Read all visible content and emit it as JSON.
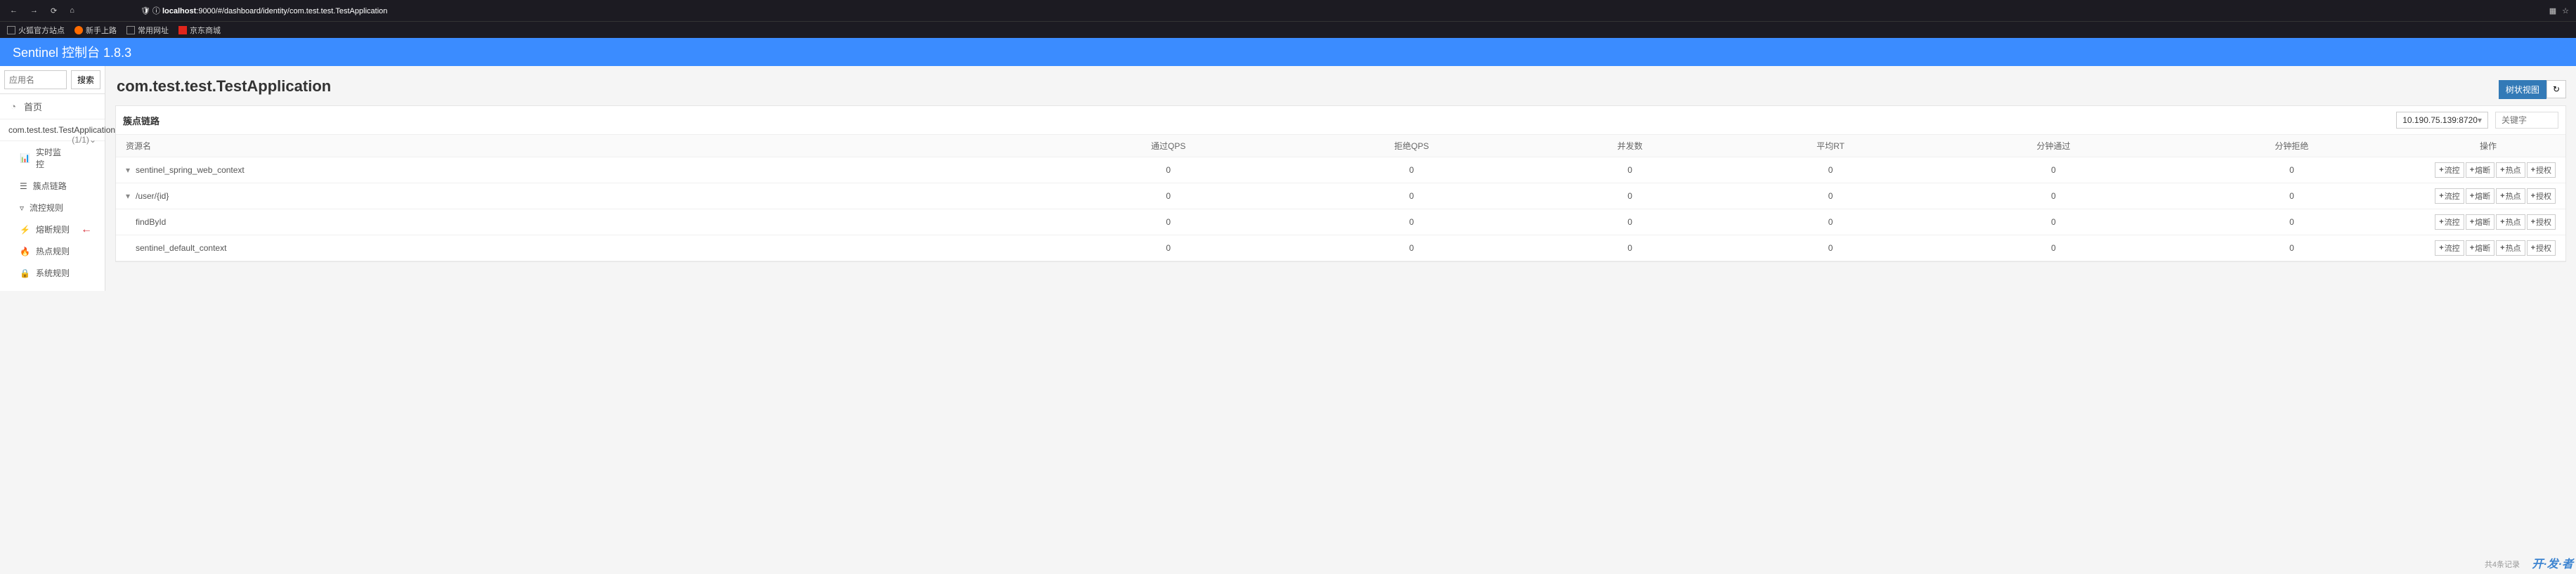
{
  "browser": {
    "url_host": "localhost",
    "url_path": ":9000/#/dashboard/identity/com.test.test.TestApplication",
    "bookmarks": [
      "火狐官方站点",
      "新手上路",
      "常用网址",
      "京东商城"
    ]
  },
  "banner": {
    "title": "Sentinel 控制台 1.8.3"
  },
  "sidebar": {
    "search_placeholder": "应用名",
    "search_btn": "搜索",
    "home": "首页",
    "app_name": "com.test.test.TestApplication",
    "app_count": "(1/1)",
    "items": [
      {
        "icon": "📊",
        "label": "实时监控"
      },
      {
        "icon": "☰",
        "label": "簇点链路"
      },
      {
        "icon": "▿",
        "label": "流控规则"
      },
      {
        "icon": "⚡",
        "label": "熔断规则",
        "pointed": true
      },
      {
        "icon": "🔥",
        "label": "热点规则"
      },
      {
        "icon": "🔒",
        "label": "系统规则"
      }
    ]
  },
  "page": {
    "title": "com.test.test.TestApplication",
    "tree_btn": "树状视图",
    "panel_title": "簇点链路",
    "machine": "10.190.75.139:8720",
    "kw_placeholder": "关键字",
    "columns": [
      "资源名",
      "通过QPS",
      "拒绝QPS",
      "并发数",
      "平均RT",
      "分钟通过",
      "分钟拒绝",
      "操作"
    ],
    "op_labels": [
      "流控",
      "熔断",
      "热点",
      "授权"
    ],
    "rows": [
      {
        "name": "sentinel_spring_web_context",
        "indent": 0,
        "toggle": "▾",
        "vals": [
          0,
          0,
          0,
          0,
          0,
          0
        ]
      },
      {
        "name": "/user/{id}",
        "indent": 1,
        "toggle": "▾",
        "vals": [
          0,
          0,
          0,
          0,
          0,
          0
        ]
      },
      {
        "name": "findById",
        "indent": 2,
        "toggle": "",
        "vals": [
          0,
          0,
          0,
          0,
          0,
          0
        ]
      },
      {
        "name": "sentinel_default_context",
        "indent": 0,
        "toggle": "",
        "vals": [
          0,
          0,
          0,
          0,
          0,
          0
        ]
      }
    ]
  },
  "footer": {
    "attrib": "共4条记录",
    "watermark": "开·发·者"
  }
}
